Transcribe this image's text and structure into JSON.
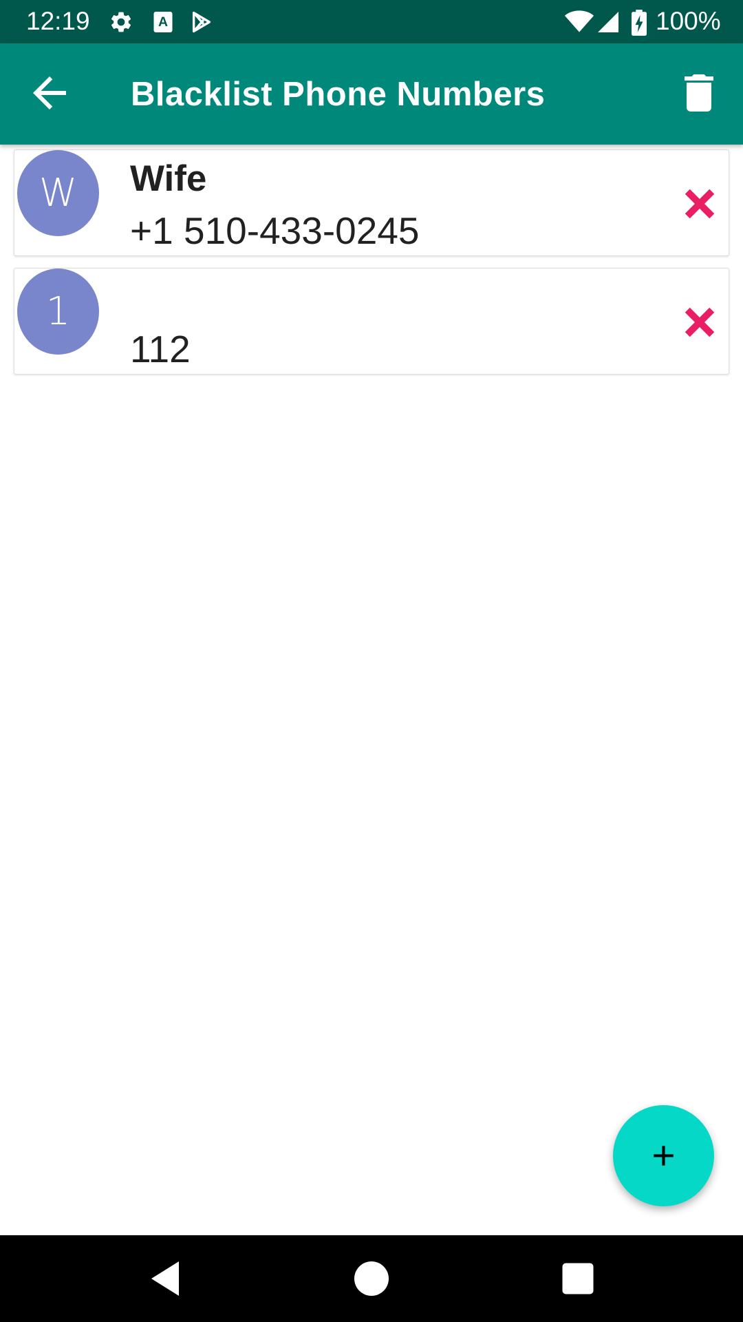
{
  "status_bar": {
    "time": "12:19",
    "battery": "100%",
    "icons": [
      "settings-icon",
      "font-a-icon",
      "play-store-icon",
      "wifi-icon",
      "signal-icon",
      "battery-charging-icon"
    ]
  },
  "app_bar": {
    "title": "Blacklist Phone Numbers",
    "back_icon": "arrow-back-icon",
    "delete_icon": "trash-icon",
    "color": "#00897b"
  },
  "contacts": [
    {
      "avatar_letter": "W",
      "name": "Wife",
      "number": "+1 510-433-0245"
    },
    {
      "avatar_letter": "1",
      "name": "",
      "number": "112"
    }
  ],
  "colors": {
    "status_bar": "#00574b",
    "avatar": "#7986cb",
    "remove": "#e91e63",
    "fab": "#05d8c6"
  },
  "fab": {
    "icon": "plus-icon"
  },
  "nav_bar": {
    "icons": [
      "back-triangle-icon",
      "home-circle-icon",
      "recents-square-icon"
    ]
  }
}
